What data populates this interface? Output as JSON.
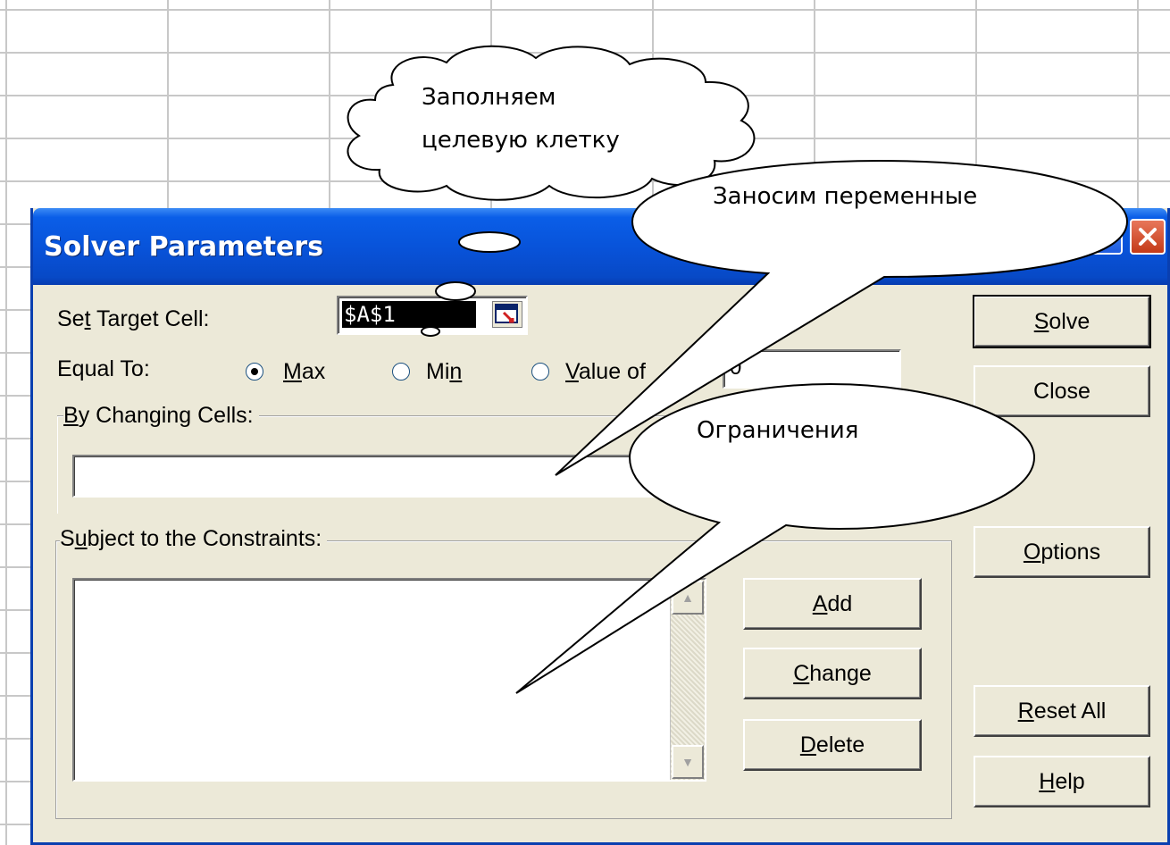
{
  "dialog": {
    "title": "Solver Parameters",
    "set_target_label_pre": "Se",
    "set_target_label_u": "t",
    "set_target_label_post": " Target Cell:",
    "target_value": "$A$1",
    "equal_to_label": "Equal To:",
    "max_u": "M",
    "max_rest": "ax",
    "min_pre": "Mi",
    "min_u": "n",
    "value_u": "V",
    "value_rest": "alue of",
    "value_input": "0",
    "changing_u": "B",
    "changing_rest": "y Changing Cells:",
    "changing_value": "",
    "constraints_pre": "S",
    "constraints_u": "u",
    "constraints_rest": "bject to the Constraints:",
    "buttons": {
      "solve_u": "S",
      "solve_rest": "olve",
      "close": "Close",
      "options_u": "O",
      "options_rest": "ptions",
      "add_u": "A",
      "add_rest": "dd",
      "change_u": "C",
      "change_rest": "hange",
      "delete_u": "D",
      "delete_rest": "elete",
      "reset_u": "R",
      "reset_rest": "eset All",
      "help_u": "H",
      "help_rest": "elp"
    },
    "selected_option": "Max"
  },
  "callouts": {
    "cloud_line1": "Заполняем",
    "cloud_line2": "целевую клетку",
    "variables": "Заносим переменные",
    "constraints": "Ограничения"
  }
}
